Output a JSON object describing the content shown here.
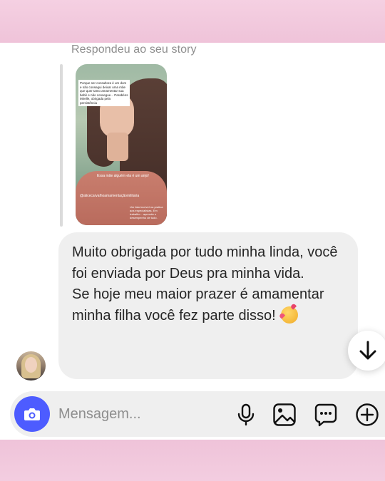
{
  "reply_context": {
    "label": "Respondeu ao seu story",
    "story": {
      "note_text": "Porque ser consultora é um dom e não consegui deixar uma mãe que quer tanto amamentar sua bebê e não consegue... Parabéns Mirelle, obrigada pela persistência",
      "caption": "Essa mãe alguém ela é um anjo!",
      "tag": "@alicecarvalhoamamentaçãomilitaria",
      "footer": "Um fato incrível na pratica aos especialistas. Em trabalho... aprenda o desempenho de tudo."
    }
  },
  "message": {
    "paragraphs": [
      "Muito obrigada por tudo minha linda, você foi enviada por Deus pra minha vida.",
      "Se hoje meu maior prazer é amamentar minha filha você fez parte disso!"
    ],
    "emoji": "smiling-face-with-hearts"
  },
  "composer": {
    "placeholder": "Mensagem...",
    "value": ""
  },
  "colors": {
    "accent": "#4d5cff",
    "bubble": "#efefef",
    "frame": "#f2c9dd"
  }
}
